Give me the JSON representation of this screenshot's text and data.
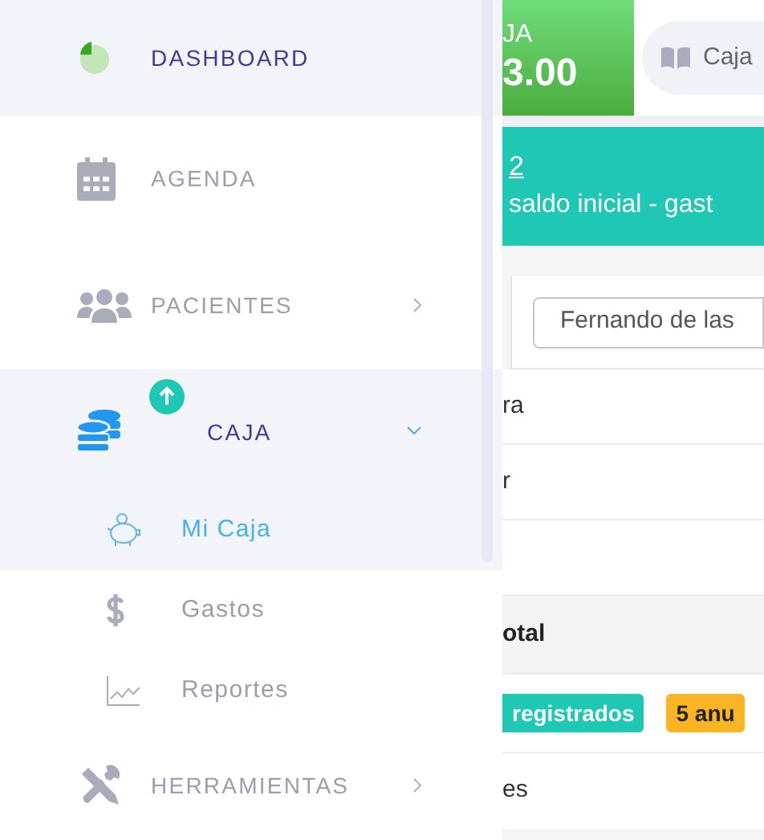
{
  "sidebar": {
    "items": [
      {
        "label": "DASHBOARD",
        "selected": true
      },
      {
        "label": "AGENDA",
        "selected": false
      },
      {
        "label": "PACIENTES",
        "selected": false,
        "expanded": false
      },
      {
        "label": "CAJA",
        "selected": true,
        "expanded": true,
        "update_badge": true,
        "children": [
          {
            "label": "Mi Caja",
            "selected": true
          },
          {
            "label": "Gastos",
            "selected": false
          },
          {
            "label": "Reportes",
            "selected": false
          }
        ]
      },
      {
        "label": "HERRAMIENTAS",
        "selected": false,
        "expanded": false
      }
    ]
  },
  "main": {
    "summary_card": {
      "title": "JA",
      "value": "3.00"
    },
    "caja_button": {
      "label": "Caja"
    },
    "banner": {
      "link": "2",
      "text": "saldo inicial - gast"
    },
    "table": {
      "filter": {
        "value": "Fernando de las"
      },
      "rows": [
        {
          "cell": "ra"
        },
        {
          "cell": "r"
        },
        {}
      ],
      "total_header": "otal",
      "badges": [
        {
          "text": "registrados",
          "color": "#1fc8b4"
        },
        {
          "text": "5 anu",
          "color": "#fbb524"
        }
      ],
      "last_row": "es"
    }
  }
}
